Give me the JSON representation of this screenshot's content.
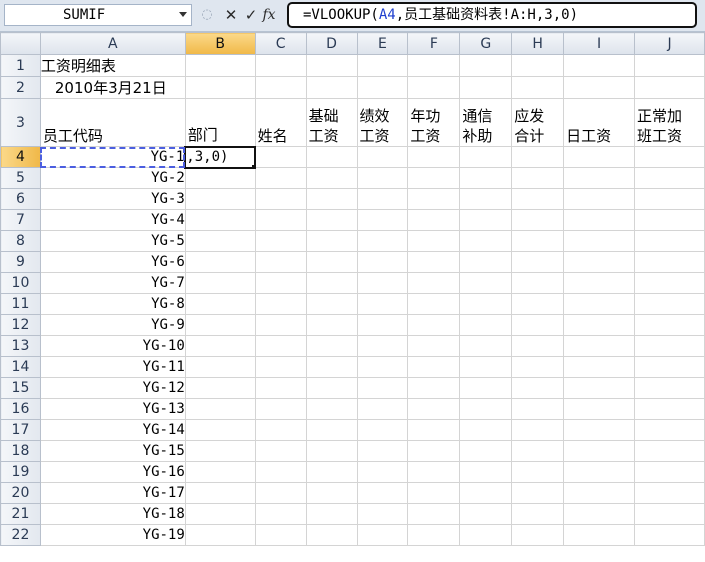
{
  "formula_bar": {
    "name_box": "SUMIF",
    "icons": [
      "function-wizard-icon",
      "cancel-icon",
      "enter-icon",
      "fx-icon"
    ],
    "cancel_glyph": "✕",
    "enter_glyph": "✓",
    "fx_glyph": "fx",
    "formula_prefix": "=VLOOKUP(",
    "formula_ref": "A4",
    "formula_suffix": ",员工基础资料表!A:H,3,0)"
  },
  "columns": [
    "A",
    "B",
    "C",
    "D",
    "E",
    "F",
    "G",
    "H",
    "I",
    "J"
  ],
  "selected_column": "B",
  "cells": {
    "A1": "工资明细表",
    "A2": "2010年3月21日",
    "A3": "员工代码",
    "B3": "部门",
    "C3": "姓名",
    "D3": [
      "基础",
      "工资"
    ],
    "E3": [
      "绩效",
      "工资"
    ],
    "F3": [
      "年功",
      "工资"
    ],
    "G3": [
      "通信",
      "补助"
    ],
    "H3": [
      "应发",
      "合计"
    ],
    "I3": "日工资",
    "J3": [
      "正常加",
      "班工资"
    ],
    "B4": ",3,0)"
  },
  "employee_codes": [
    "YG-1",
    "YG-2",
    "YG-3",
    "YG-4",
    "YG-5",
    "YG-6",
    "YG-7",
    "YG-8",
    "YG-9",
    "YG-10",
    "YG-11",
    "YG-12",
    "YG-13",
    "YG-14",
    "YG-15",
    "YG-16",
    "YG-17",
    "YG-18",
    "YG-19"
  ],
  "row_numbers": [
    "1",
    "2",
    "3",
    "4",
    "5",
    "6",
    "7",
    "8",
    "9",
    "10",
    "11",
    "12",
    "13",
    "14",
    "15",
    "16",
    "17",
    "18",
    "19",
    "20",
    "21",
    "22"
  ],
  "active_cell": "B4",
  "colors": {
    "reference_blue": "#1f3fcf",
    "selected_header": "#f0b848"
  }
}
